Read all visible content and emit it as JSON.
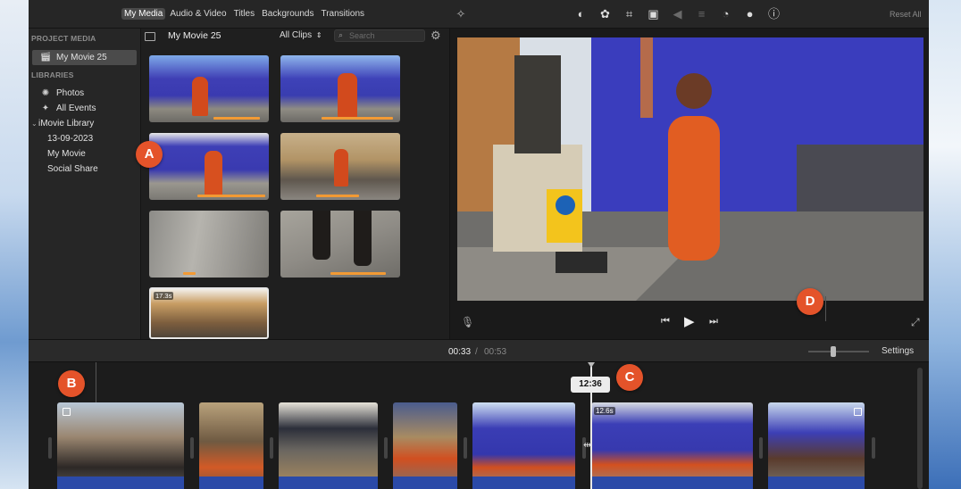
{
  "colors": {
    "accent_orange": "#E4532A",
    "audio_blue": "#2B4AA8",
    "used_marker": "#F29A34"
  },
  "toolbar": {
    "media_tabs": [
      "My Media",
      "Audio & Video",
      "Titles",
      "Backgrounds",
      "Transitions"
    ],
    "active_tab": "My Media",
    "tool_icons": [
      "color-balance-icon",
      "color-correction-icon",
      "crop-icon",
      "stabilization-icon",
      "volume-icon",
      "equalizer-icon",
      "speed-icon",
      "noise-reduction-icon",
      "info-icon"
    ],
    "reset_all": "Reset All"
  },
  "sidebar": {
    "project_media_header": "PROJECT MEDIA",
    "project_item": "My Movie 25",
    "libraries_header": "LIBRARIES",
    "photos": "Photos",
    "all_events": "All Events",
    "library": "iMovie Library",
    "library_items": [
      "13-09-2023",
      "My Movie",
      "Social Share"
    ]
  },
  "browser": {
    "title": "My Movie 25",
    "filter": "All Clips",
    "search_placeholder": "Search",
    "selected_clip_duration": "17.3s"
  },
  "timeline": {
    "current_time": "00:33",
    "separator": "/",
    "total_time": "00:53",
    "settings": "Settings",
    "playhead_time": "12:36",
    "clip_duration_label": "12.6s",
    "zoom_level": 0.4
  },
  "callouts": {
    "a": "A",
    "b": "B",
    "c": "C",
    "d": "D"
  }
}
